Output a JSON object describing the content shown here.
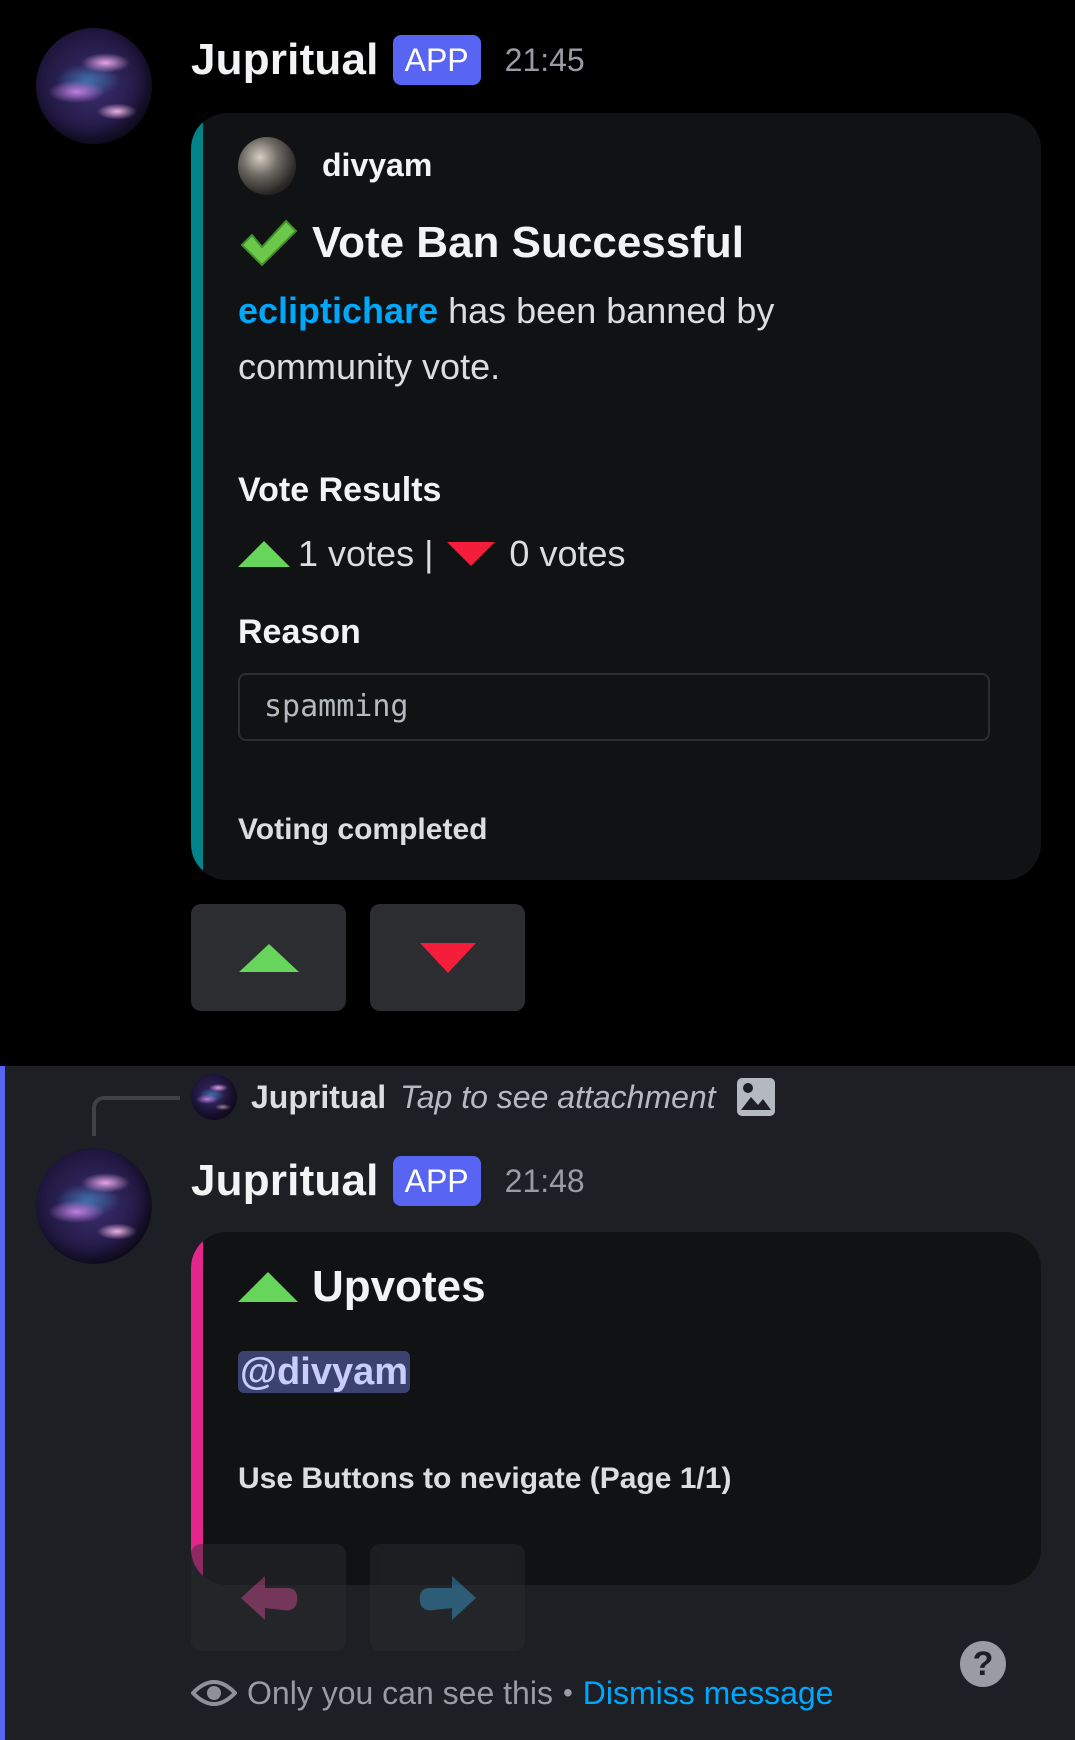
{
  "colors": {
    "accent_teal": "#00848a",
    "accent_pink": "#e3268c",
    "blurple": "#5865f2",
    "link": "#00a8fc",
    "upvote": "#67d55b",
    "downvote": "#f41e3b"
  },
  "message1": {
    "username": "Jupritual",
    "badge": "APP",
    "time": "21:45",
    "embed": {
      "author": "divyam",
      "title_icon": "check-mark-icon",
      "title": "Vote Ban Successful",
      "desc_user": "ecliptichare",
      "desc_text_1": " has been banned by",
      "desc_text_2": "community vote.",
      "field1_name": "Vote Results",
      "up_count": "1 votes |",
      "down_count": "0 votes",
      "field2_name": "Reason",
      "reason": "spamming",
      "footer": "Voting completed"
    },
    "buttons": [
      {
        "icon": "upvote-triangle-icon"
      },
      {
        "icon": "downvote-triangle-icon"
      }
    ]
  },
  "message2": {
    "reply": {
      "username": "Jupritual",
      "text": "Tap to see attachment",
      "icon": "image-attachment-icon"
    },
    "username": "Jupritual",
    "badge": "APP",
    "time": "21:48",
    "embed": {
      "title": "Upvotes",
      "mention": "@divyam",
      "footer": "Use Buttons to nevigate (Page 1/1)"
    },
    "buttons": [
      {
        "icon": "left-arrow-icon"
      },
      {
        "icon": "right-arrow-icon"
      }
    ],
    "ephemeral": {
      "text": "Only you can see this",
      "separator": "•",
      "dismiss": "Dismiss message",
      "help_icon": "help-icon"
    }
  }
}
